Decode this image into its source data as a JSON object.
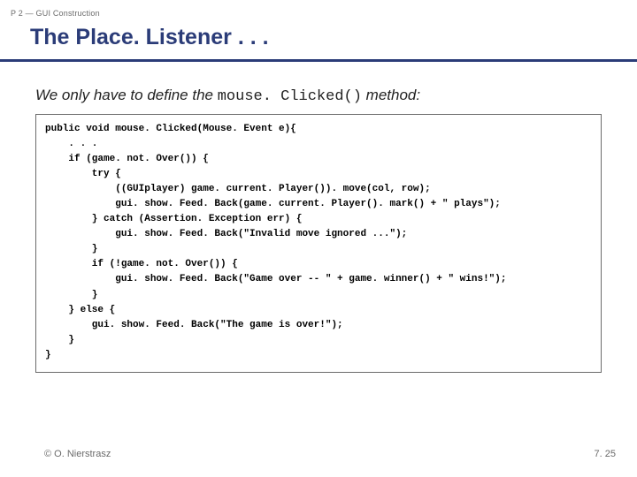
{
  "breadcrumb": "P 2 — GUI Construction",
  "title": "The Place. Listener . . .",
  "lead_prefix": "We only have to define the ",
  "lead_code": "mouse. Clicked()",
  "lead_suffix": " method:",
  "code": "public void mouse. Clicked(Mouse. Event e){\n    . . .\n    if (game. not. Over()) {\n        try {\n            ((GUIplayer) game. current. Player()). move(col, row);\n            gui. show. Feed. Back(game. current. Player(). mark() + \" plays\");\n        } catch (Assertion. Exception err) {\n            gui. show. Feed. Back(\"Invalid move ignored ...\");\n        }\n        if (!game. not. Over()) {\n            gui. show. Feed. Back(\"Game over -- \" + game. winner() + \" wins!\");\n        }\n    } else {\n        gui. show. Feed. Back(\"The game is over!\");\n    }\n}",
  "footer_left": "© O. Nierstrasz",
  "footer_right": "7. 25"
}
